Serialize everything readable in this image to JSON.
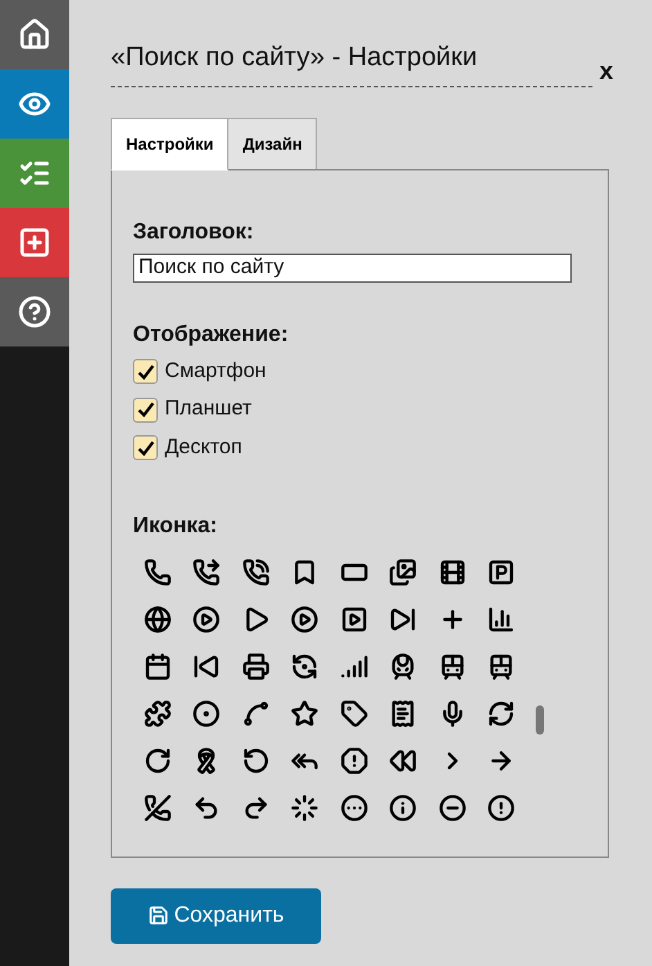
{
  "sidebar": {
    "items": [
      {
        "kind": "home",
        "color": "#5a5a5a"
      },
      {
        "kind": "view",
        "color": "#0b7bb8"
      },
      {
        "kind": "list",
        "color": "#4b933a"
      },
      {
        "kind": "add",
        "color": "#d8383c"
      },
      {
        "kind": "help",
        "color": "#5a5a5a"
      }
    ]
  },
  "dialog": {
    "title": "«Поиск по сайту» - Настройки",
    "close": "x"
  },
  "tabs": [
    {
      "label": "Настройки",
      "selected": true
    },
    {
      "label": "Дизайн",
      "selected": false
    }
  ],
  "heading_field": {
    "label": "Заголовок:",
    "value": "Поиск по сайту"
  },
  "display": {
    "label": "Отображение:",
    "options": [
      {
        "label": "Смартфон",
        "checked": true
      },
      {
        "label": "Планшет",
        "checked": true
      },
      {
        "label": "Десктоп",
        "checked": true
      }
    ]
  },
  "icon_picker": {
    "label": "Иконка:"
  },
  "save_button": {
    "label": "Сохранить"
  }
}
